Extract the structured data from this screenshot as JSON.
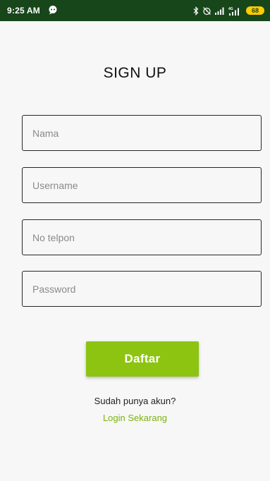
{
  "status_bar": {
    "time": "9:25 AM",
    "battery": "68",
    "network_label": "4G",
    "icons": [
      "chat-icon",
      "bluetooth-icon",
      "alarm-off-icon",
      "signal-icon",
      "signal-4g-icon",
      "battery-icon"
    ]
  },
  "page": {
    "title": "SIGN UP"
  },
  "form": {
    "name_placeholder": "Nama",
    "username_placeholder": "Username",
    "phone_placeholder": "No telpon",
    "password_placeholder": "Password",
    "submit_label": "Daftar"
  },
  "footer": {
    "prompt": "Sudah punya akun?",
    "login_link": "Login Sekarang"
  },
  "colors": {
    "status_bar": "#17461b",
    "accent": "#8dc412",
    "link": "#7bb30d",
    "battery": "#ffcc00"
  }
}
